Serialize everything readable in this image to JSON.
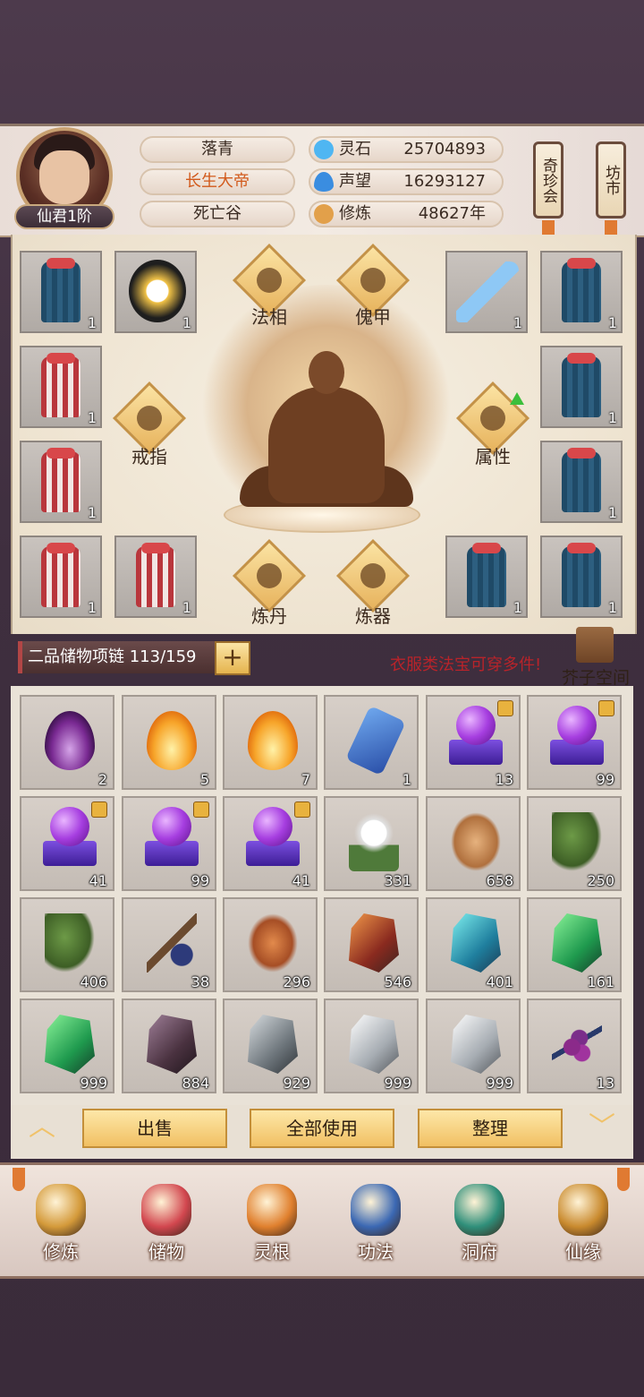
{
  "player": {
    "name": "落青",
    "title": "长生大帝",
    "location": "死亡谷",
    "rank": "仙君1阶"
  },
  "stats": [
    {
      "label": "灵石",
      "value": "25704893",
      "icon": "spirit-stone-icon",
      "color": "#4fb6f2"
    },
    {
      "label": "声望",
      "value": "16293127",
      "icon": "prestige-flame-icon",
      "color": "#3a8de0"
    },
    {
      "label": "修炼",
      "value": "48627年",
      "icon": "meditation-icon",
      "color": "#e2a04a"
    }
  ],
  "top_buttons": [
    {
      "label": "奇珍会"
    },
    {
      "label": "坊市"
    }
  ],
  "equipment": {
    "slots": [
      {
        "id": "s1",
        "kind": "blue-robe",
        "count": "1"
      },
      {
        "id": "s2",
        "kind": "gold-armor",
        "count": "1"
      },
      {
        "id": "s3",
        "kind": "sword",
        "count": "1"
      },
      {
        "id": "s4",
        "kind": "blue-robe",
        "count": "1"
      },
      {
        "id": "s5",
        "kind": "red-robe",
        "count": "1"
      },
      {
        "id": "s6",
        "kind": "blue-robe",
        "count": "1"
      },
      {
        "id": "s7",
        "kind": "red-robe",
        "count": "1"
      },
      {
        "id": "s8",
        "kind": "blue-robe",
        "count": "1"
      },
      {
        "id": "s9",
        "kind": "red-robe",
        "count": "1"
      },
      {
        "id": "s10",
        "kind": "red-robe",
        "count": "1"
      },
      {
        "id": "s11",
        "kind": "blue-robe",
        "count": "1"
      },
      {
        "id": "s12",
        "kind": "blue-robe",
        "count": "1"
      }
    ],
    "functions": [
      {
        "label": "法相",
        "icon": "dharma-form-icon"
      },
      {
        "label": "傀甲",
        "icon": "puppet-armor-icon"
      },
      {
        "label": "戒指",
        "icon": "ring-icon"
      },
      {
        "label": "属性",
        "icon": "attributes-icon"
      },
      {
        "label": "炼丹",
        "icon": "alchemy-cauldron-icon"
      },
      {
        "label": "炼器",
        "icon": "anvil-icon"
      }
    ]
  },
  "bag": {
    "name": "二品储物项链",
    "capacity": "113/159",
    "add_label": "+",
    "hint": "衣服类法宝可穿多件!",
    "space_label": "芥子空间"
  },
  "inventory": [
    {
      "art": "a-flame-purple",
      "count": "2",
      "locked": false,
      "name": "purple-flame"
    },
    {
      "art": "a-flame-orange",
      "count": "5",
      "locked": false,
      "name": "orange-flame"
    },
    {
      "art": "a-flame-orange",
      "count": "7",
      "locked": false,
      "name": "orange-flame"
    },
    {
      "art": "a-blue-rune",
      "count": "1",
      "locked": false,
      "name": "blue-rune"
    },
    {
      "art": "orb",
      "count": "13",
      "locked": true,
      "name": "purple-orb"
    },
    {
      "art": "orb",
      "count": "99",
      "locked": true,
      "name": "purple-orb"
    },
    {
      "art": "orb",
      "count": "41",
      "locked": true,
      "name": "purple-orb"
    },
    {
      "art": "orb",
      "count": "99",
      "locked": true,
      "name": "purple-orb"
    },
    {
      "art": "orb",
      "count": "41",
      "locked": true,
      "name": "purple-orb"
    },
    {
      "art": "a-flower",
      "count": "331",
      "locked": false,
      "name": "white-flower"
    },
    {
      "art": "a-root",
      "count": "658",
      "locked": false,
      "name": "ginseng-root"
    },
    {
      "art": "a-herb",
      "count": "250",
      "locked": false,
      "name": "herb"
    },
    {
      "art": "a-herb",
      "count": "406",
      "locked": false,
      "name": "flower-herb"
    },
    {
      "art": "a-branch",
      "count": "38",
      "locked": false,
      "name": "fruit-branch"
    },
    {
      "art": "a-worm",
      "count": "296",
      "locked": false,
      "name": "cordyceps"
    },
    {
      "art": "a-crystal-red",
      "count": "546",
      "locked": false,
      "name": "red-ore"
    },
    {
      "art": "a-crystal-cyan",
      "count": "401",
      "locked": false,
      "name": "cyan-ore"
    },
    {
      "art": "a-crystal-green",
      "count": "161",
      "locked": false,
      "name": "green-ore"
    },
    {
      "art": "a-crystal-green",
      "count": "999",
      "locked": false,
      "name": "green-ore"
    },
    {
      "art": "a-crystal-dark",
      "count": "884",
      "locked": false,
      "name": "dark-ore"
    },
    {
      "art": "a-crystal-gray",
      "count": "929",
      "locked": false,
      "name": "gray-ore"
    },
    {
      "art": "a-crystal-silver",
      "count": "999",
      "locked": false,
      "name": "silver-ore"
    },
    {
      "art": "a-crystal-silver",
      "count": "999",
      "locked": false,
      "name": "silver-ore"
    },
    {
      "art": "a-berry",
      "count": "13",
      "locked": false,
      "name": "berry-branch"
    }
  ],
  "actions": [
    {
      "label": "出售"
    },
    {
      "label": "全部使用"
    },
    {
      "label": "整理"
    }
  ],
  "nav": [
    {
      "label": "修炼",
      "icon": "meditate-icon",
      "color": "#d49a3a"
    },
    {
      "label": "储物",
      "icon": "storage-bag-icon",
      "color": "#d2474f"
    },
    {
      "label": "灵根",
      "icon": "spirit-root-icon",
      "color": "#e0802e"
    },
    {
      "label": "功法",
      "icon": "scripture-book-icon",
      "color": "#3b68b3"
    },
    {
      "label": "洞府",
      "icon": "cave-dwelling-icon",
      "color": "#2f8f7a"
    },
    {
      "label": "仙缘",
      "icon": "gourd-icon",
      "color": "#c98a2e"
    }
  ]
}
